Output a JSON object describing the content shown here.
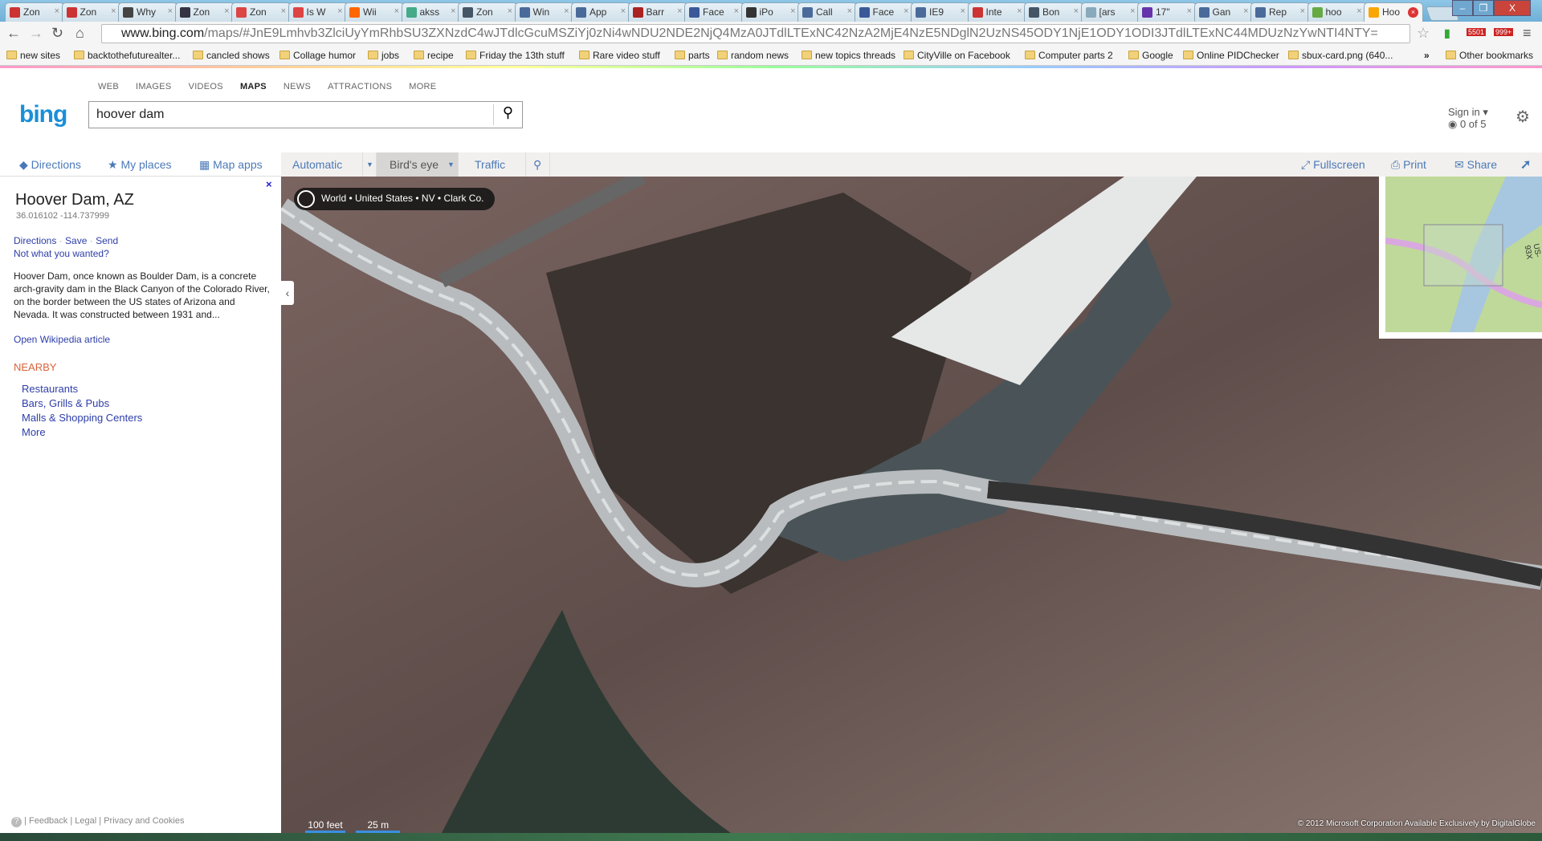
{
  "browser": {
    "tabs": [
      {
        "label": "Zon",
        "color": "#c33"
      },
      {
        "label": "Zon",
        "color": "#c33"
      },
      {
        "label": "Why",
        "color": "#444"
      },
      {
        "label": "Zon",
        "color": "#334"
      },
      {
        "label": "Zon",
        "color": "#d44"
      },
      {
        "label": "Is W",
        "color": "#d44"
      },
      {
        "label": "Wii",
        "color": "#f60"
      },
      {
        "label": "akss",
        "color": "#4a8"
      },
      {
        "label": "Zon",
        "color": "#456"
      },
      {
        "label": "Win",
        "color": "#4a6a9a"
      },
      {
        "label": "App",
        "color": "#4a6a9a"
      },
      {
        "label": "Barr",
        "color": "#a22"
      },
      {
        "label": "Face",
        "color": "#3b5998"
      },
      {
        "label": "iPo",
        "color": "#333"
      },
      {
        "label": "Call",
        "color": "#4a6a9a"
      },
      {
        "label": "Face",
        "color": "#3b5998"
      },
      {
        "label": "IE9",
        "color": "#4a6a9a"
      },
      {
        "label": "Inte",
        "color": "#c33"
      },
      {
        "label": "Bon",
        "color": "#456"
      },
      {
        "label": "[ars",
        "color": "#8ab"
      },
      {
        "label": "17\"",
        "color": "#63a"
      },
      {
        "label": "Gan",
        "color": "#4a6a9a"
      },
      {
        "label": "Rep",
        "color": "#4a6a9a"
      },
      {
        "label": "hoo",
        "color": "#6a4"
      },
      {
        "label": "Hoo",
        "color": "#f9a602",
        "active": true
      }
    ],
    "url_host": "www.bing.com",
    "url_path": "/maps/#JnE9Lmhvb3ZlciUyYmRhbSU3ZXNzdC4wJTdlcGcuMSZiYj0zNi4wNDU2NDE2NjQ4MzA0JTdlLTExNC42NzA2MjE4NzE5NDglN2UzNS45ODY1NjE1ODY1ODI3JTdlLTExNC44MDUzNzYwNTI4NTY=",
    "extensions": {
      "gmail_count": "5501",
      "s_count": "999+"
    },
    "bookmarks": [
      "new sites",
      "backtothefuturealter...",
      "cancled shows",
      "Collage humor",
      "jobs",
      "recipe",
      "Friday the 13th stuff",
      "Rare video stuff",
      "parts",
      "random news",
      "new topics threads",
      "CityVille on Facebook",
      "Computer parts 2",
      "Google",
      "Online PIDChecker",
      "sbux-card.png (640..."
    ],
    "other_bookmarks": "Other bookmarks",
    "overflow": "»"
  },
  "bing": {
    "nav": [
      "WEB",
      "IMAGES",
      "VIDEOS",
      "MAPS",
      "NEWS",
      "ATTRACTIONS",
      "MORE"
    ],
    "logo": "bing",
    "query": "hoover dam",
    "sign_in": "Sign in ▾",
    "rewards": "0 of 5"
  },
  "map_toolbar": {
    "directions": "Directions",
    "my_places": "My places",
    "map_apps": "Map apps",
    "automatic": "Automatic",
    "birds_eye": "Bird's eye",
    "traffic": "Traffic",
    "fullscreen": "Fullscreen",
    "print": "Print",
    "share": "Share"
  },
  "panel": {
    "title": "Hoover Dam, AZ",
    "coords": "36.016102 -114.737999",
    "actions": [
      "Directions",
      "Save",
      "Send"
    ],
    "not_wanted": "Not what you wanted?",
    "description": "Hoover Dam, once known as Boulder Dam, is a concrete arch-gravity dam in the Black Canyon of the Colorado River, on the border between the US states of Arizona and Nevada. It was constructed between 1931 and...",
    "wiki": "Open Wikipedia article",
    "nearby_title": "NEARBY",
    "nearby": [
      "Restaurants",
      "Bars, Grills & Pubs",
      "Malls & Shopping Centers",
      "More"
    ],
    "footer": [
      "Feedback",
      "Legal",
      "Privacy and Cookies"
    ]
  },
  "map": {
    "breadcrumb": "World • United States • NV • Clark Co.",
    "minimap_label": "US-93X",
    "scale_feet": "100 feet",
    "scale_m": "25 m",
    "copyright": "© 2012 Microsoft Corporation    Available Exclusively by DigitalGlobe"
  }
}
